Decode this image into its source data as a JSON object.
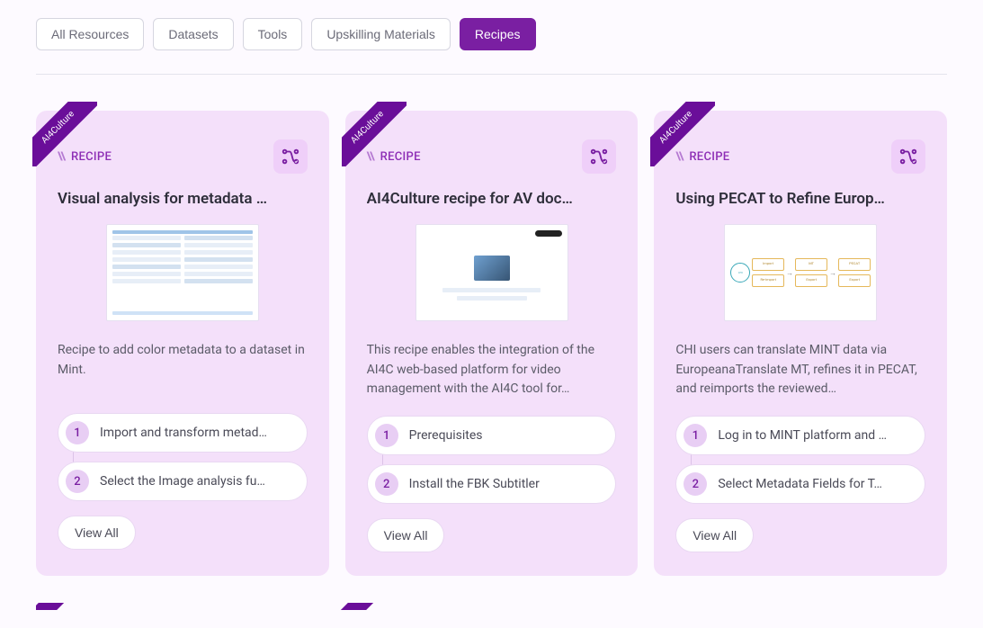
{
  "tabs": [
    {
      "label": "All Resources",
      "active": false
    },
    {
      "label": "Datasets",
      "active": false
    },
    {
      "label": "Tools",
      "active": false
    },
    {
      "label": "Upskilling Materials",
      "active": false
    },
    {
      "label": "Recipes",
      "active": true
    }
  ],
  "ribbon_label": "AI4Culture",
  "recipe_prefix": "\\\\",
  "recipe_label": "RECIPE",
  "view_all_label": "View All",
  "cards": [
    {
      "title": "Visual analysis for metadata …",
      "description": "Recipe to add color metadata to a dataset in Mint.",
      "steps": [
        {
          "num": "1",
          "text": "Import and transform metad…"
        },
        {
          "num": "2",
          "text": "Select the Image analysis fu…"
        }
      ]
    },
    {
      "title": "AI4Culture recipe for AV doc…",
      "description": "This recipe enables the integration of the AI4C web-based platform for video management with the AI4C tool for…",
      "steps": [
        {
          "num": "1",
          "text": "Prerequisites"
        },
        {
          "num": "2",
          "text": "Install the FBK Subtitler"
        }
      ]
    },
    {
      "title": "Using PECAT to Refine Europ…",
      "description": "CHI users can translate MINT data via EuropeanaTranslate MT, refines it in PECAT, and reimports the reviewed…",
      "steps": [
        {
          "num": "1",
          "text": "Log in to MINT platform and …"
        },
        {
          "num": "2",
          "text": "Select Metadata Fields for T…"
        }
      ]
    }
  ]
}
